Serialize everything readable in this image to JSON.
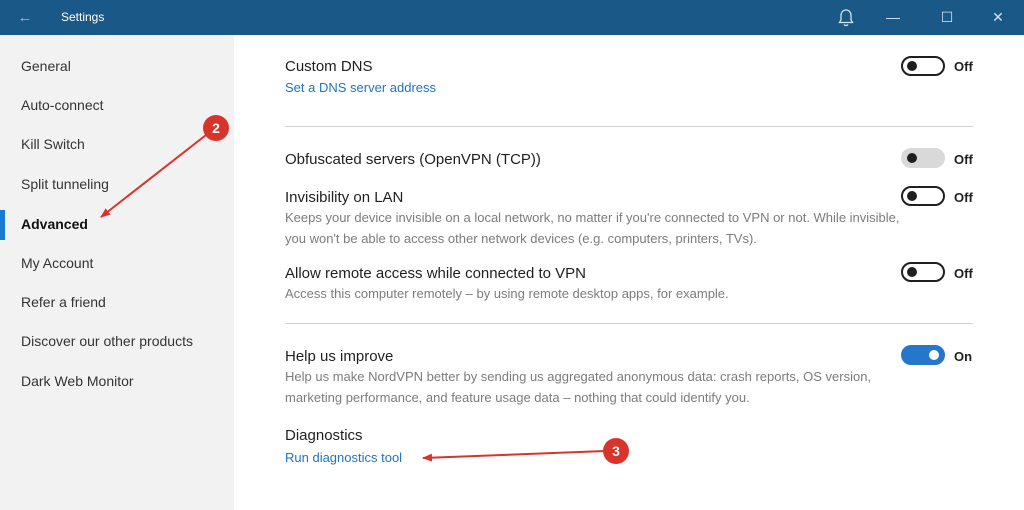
{
  "window": {
    "title": "Settings",
    "back_icon": "arrow-left-icon",
    "bell_icon": "bell-icon",
    "minimize_glyph": "—",
    "maximize_glyph": "☐",
    "close_glyph": "✕",
    "titlebar_color": "#1a5888"
  },
  "sidebar": {
    "items": [
      {
        "label": "General"
      },
      {
        "label": "Auto-connect"
      },
      {
        "label": "Kill Switch"
      },
      {
        "label": "Split tunneling"
      },
      {
        "label": "Advanced",
        "active": true
      },
      {
        "label": "My Account"
      },
      {
        "label": "Refer a friend"
      },
      {
        "label": "Discover our other products"
      },
      {
        "label": "Dark Web Monitor"
      }
    ]
  },
  "settings": {
    "custom_dns": {
      "title": "Custom DNS",
      "link": "Set a DNS server address",
      "state": "Off"
    },
    "obfuscated": {
      "title": "Obfuscated servers (OpenVPN (TCP))",
      "state": "Off",
      "enabled": false
    },
    "invisibility": {
      "title": "Invisibility on LAN",
      "desc_line1": "Keeps your device invisible on a local network, no matter if you're connected to VPN or not. While invisible,",
      "desc_line2": "you won't be able to access other network devices (e.g. computers, printers, TVs).",
      "state": "Off"
    },
    "remote_access": {
      "title": "Allow remote access while connected to VPN",
      "desc": "Access this computer remotely – by using remote desktop apps, for example.",
      "state": "Off"
    },
    "help_improve": {
      "title": "Help us improve",
      "desc_line1": "Help us make NordVPN better by sending us aggregated anonymous data: crash reports, OS version,",
      "desc_line2": "marketing performance, and feature usage data – nothing that could identify you.",
      "state": "On"
    },
    "diagnostics": {
      "title": "Diagnostics",
      "link": "Run diagnostics tool"
    }
  },
  "annotations": {
    "badge_2": "2",
    "badge_3": "3",
    "color": "#d9342b"
  },
  "colors": {
    "accent": "#2677c9",
    "link": "#1f73c8",
    "sidebar_bg": "#f2f2f2"
  }
}
